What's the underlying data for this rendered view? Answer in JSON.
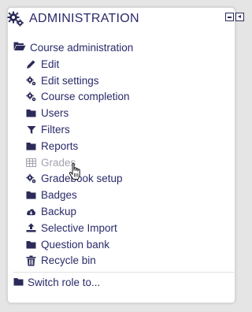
{
  "block": {
    "title": "ADMINISTRATION",
    "controls": [
      "minimize-icon",
      "dock-icon"
    ]
  },
  "course_admin": {
    "label": "Course administration",
    "icon": "folder-open-icon"
  },
  "items": [
    {
      "label": "Edit",
      "icon": "pencil-icon"
    },
    {
      "label": "Edit settings",
      "icon": "cogs-icon"
    },
    {
      "label": "Course completion",
      "icon": "cogs-icon"
    },
    {
      "label": "Users",
      "icon": "folder-icon"
    },
    {
      "label": "Filters",
      "icon": "filter-icon"
    },
    {
      "label": "Reports",
      "icon": "folder-icon"
    },
    {
      "label": "Grades",
      "icon": "table-icon",
      "state": "dimmed-hover"
    },
    {
      "label": "Gradebook setup",
      "icon": "cogs-icon"
    },
    {
      "label": "Badges",
      "icon": "folder-icon"
    },
    {
      "label": "Backup",
      "icon": "cloud-download-icon"
    },
    {
      "label": "Selective Import",
      "icon": "upload-icon"
    },
    {
      "label": "Question bank",
      "icon": "folder-icon"
    },
    {
      "label": "Recycle bin",
      "icon": "trash-icon"
    }
  ],
  "switch_role": {
    "label": "Switch role to...",
    "icon": "folder-icon"
  },
  "colors": {
    "text": "#2a2a6a",
    "dimmed": "#a3a3b0",
    "border": "#d6d6d6",
    "background": "#e5e5e5"
  }
}
